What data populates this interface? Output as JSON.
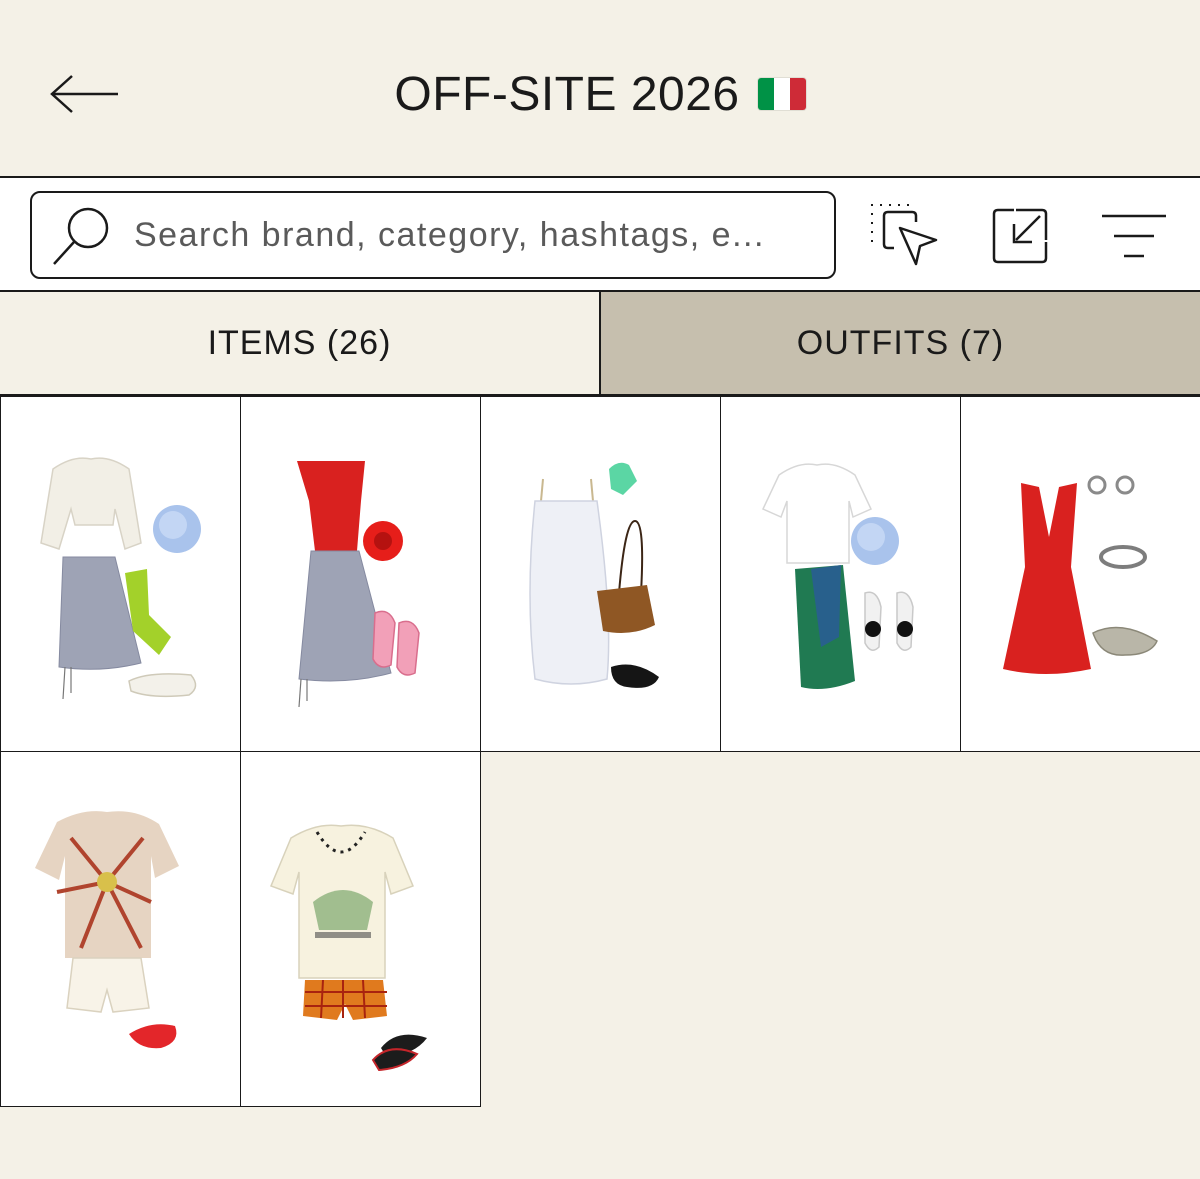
{
  "header": {
    "back_label": "Back",
    "title": "OFF-SITE 2026",
    "flag_colors": [
      "#009246",
      "#ffffff",
      "#ce2b37"
    ]
  },
  "search": {
    "placeholder": "Search brand, category, hashtags, e..."
  },
  "toolbar": {
    "select_icon": "select-cursor-icon",
    "export_icon": "resize-arrow-icon",
    "filter_icon": "filter-lines-icon"
  },
  "tabs": [
    {
      "label": "ITEMS (26)",
      "active": false
    },
    {
      "label": "OUTFITS (7)",
      "active": true
    }
  ],
  "outfits": [
    {
      "icon": "outfit-white-blouse-grey-skirt"
    },
    {
      "icon": "outfit-red-top-grey-skirt"
    },
    {
      "icon": "outfit-white-slip-dress-brown-bag"
    },
    {
      "icon": "outfit-white-tee-green-skirt"
    },
    {
      "icon": "outfit-red-midi-dress"
    },
    {
      "icon": "outfit-tie-dye-tee-lace-shorts"
    },
    {
      "icon": "outfit-washington-tee-plaid-shorts"
    }
  ],
  "colors": {
    "background": "#f4f1e7",
    "active_tab": "#c6bfae",
    "line": "#1a1a1a"
  }
}
